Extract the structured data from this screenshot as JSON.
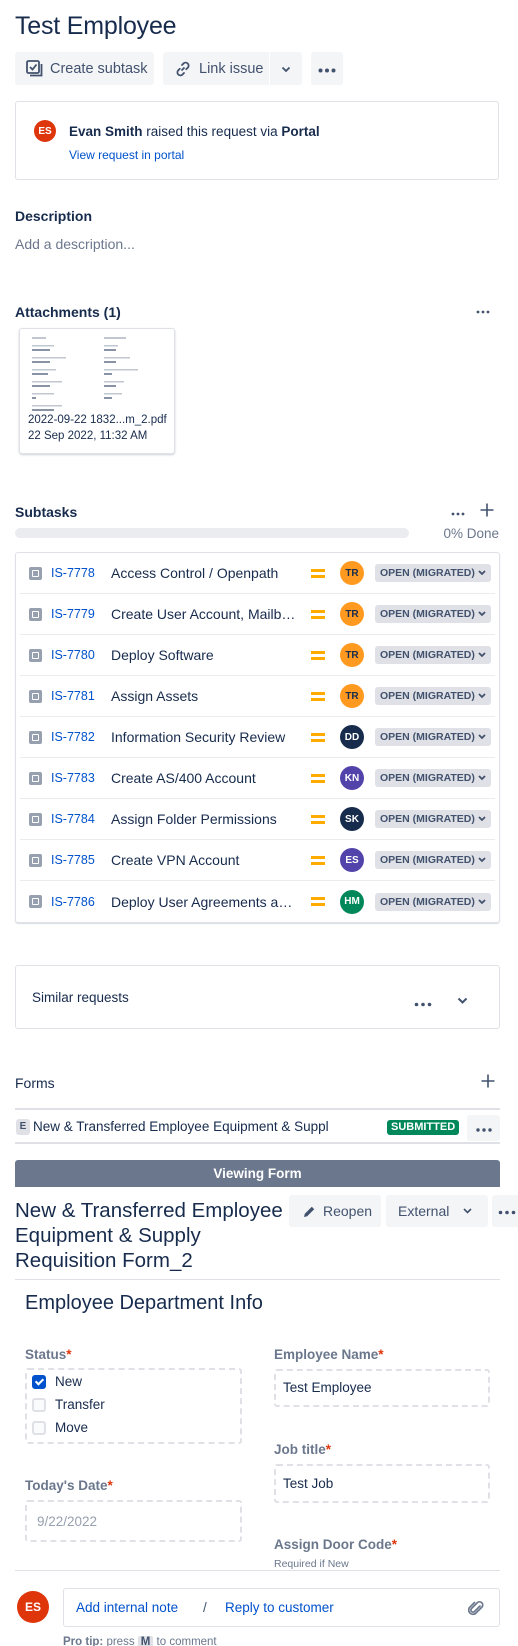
{
  "issue": {
    "title": "Test Employee"
  },
  "toolbar": {
    "create_subtask": "Create subtask",
    "link_issue": "Link issue",
    "more_icon": "more-horizontal-icon"
  },
  "raised": {
    "avatar_initials": "ES",
    "avatar_color": "#de350b",
    "reporter": "Evan Smith",
    "middle": " raised this request via ",
    "channel": "Portal",
    "view_link": "View request in portal"
  },
  "description": {
    "label": "Description",
    "placeholder": "Add a description..."
  },
  "attachments": {
    "label": "Attachments (1)",
    "files": [
      {
        "name": "2022-09-22 1832...m_2.pdf",
        "date": "22 Sep 2022, 11:32 AM"
      }
    ]
  },
  "subtasks": {
    "label": "Subtasks",
    "progress_percent": 0,
    "progress_text": "0% Done",
    "items": [
      {
        "key": "IS-7778",
        "summary": "Access Control / Openpath",
        "priority": "medium",
        "assignee": "TR",
        "assignee_color": "#ff991f",
        "assignee_text_color": "#172b4d",
        "status": "OPEN (MIGRATED)"
      },
      {
        "key": "IS-7779",
        "summary": "Create User Account, Mailbo...",
        "priority": "medium",
        "assignee": "TR",
        "assignee_color": "#ff991f",
        "assignee_text_color": "#172b4d",
        "status": "OPEN (MIGRATED)"
      },
      {
        "key": "IS-7780",
        "summary": "Deploy Software",
        "priority": "medium",
        "assignee": "TR",
        "assignee_color": "#ff991f",
        "assignee_text_color": "#172b4d",
        "status": "OPEN (MIGRATED)"
      },
      {
        "key": "IS-7781",
        "summary": "Assign Assets",
        "priority": "medium",
        "assignee": "TR",
        "assignee_color": "#ff991f",
        "assignee_text_color": "#172b4d",
        "status": "OPEN (MIGRATED)"
      },
      {
        "key": "IS-7782",
        "summary": "Information Security Review",
        "priority": "medium",
        "assignee": "DD",
        "assignee_color": "#172b4d",
        "assignee_text_color": "#ffffff",
        "status": "OPEN (MIGRATED)"
      },
      {
        "key": "IS-7783",
        "summary": "Create AS/400 Account",
        "priority": "medium",
        "assignee": "KN",
        "assignee_color": "#5243aa",
        "assignee_text_color": "#ffffff",
        "status": "OPEN (MIGRATED)"
      },
      {
        "key": "IS-7784",
        "summary": "Assign Folder Permissions",
        "priority": "medium",
        "assignee": "SK",
        "assignee_color": "#172b4d",
        "assignee_text_color": "#ffffff",
        "status": "OPEN (MIGRATED)"
      },
      {
        "key": "IS-7785",
        "summary": "Create VPN Account",
        "priority": "medium",
        "assignee": "ES",
        "assignee_color": "#5243aa",
        "assignee_text_color": "#ffffff",
        "status": "OPEN (MIGRATED)"
      },
      {
        "key": "IS-7786",
        "summary": "Deploy User Agreements an...",
        "priority": "medium",
        "assignee": "HM",
        "assignee_color": "#00875a",
        "assignee_text_color": "#ffffff",
        "status": "OPEN (MIGRATED)"
      }
    ]
  },
  "similar": {
    "label": "Similar requests"
  },
  "forms": {
    "label": "Forms",
    "items": [
      {
        "badge": "E",
        "name": "New & Transferred Employee Equipment & Suppl",
        "status": "SUBMITTED",
        "status_color": "#00875a"
      }
    ],
    "viewing_banner": "Viewing Form",
    "form_title": "New & Transferred Employee Equipment & Supply Requisition Form_2",
    "reopen": "Reopen",
    "visibility": "External",
    "section_heading": "Employee Department Info",
    "fields": {
      "status": {
        "label": "Status",
        "required": "*",
        "options": [
          {
            "label": "New",
            "checked": true
          },
          {
            "label": "Transfer",
            "checked": false
          },
          {
            "label": "Move",
            "checked": false
          }
        ]
      },
      "employee_name": {
        "label": "Employee Name",
        "required": "*",
        "value": "Test Employee"
      },
      "job_title": {
        "label": "Job title",
        "required": "*",
        "value": "Test Job"
      },
      "todays_date": {
        "label": "Today's Date",
        "required": "*",
        "value": "9/22/2022"
      },
      "door_code": {
        "label": "Assign Door Code",
        "required": "*",
        "help": "Required if New"
      }
    }
  },
  "comment": {
    "avatar_initials": "ES",
    "avatar_color": "#de350b",
    "internal_note": "Add internal note",
    "separator": "/",
    "reply": "Reply to customer",
    "pro_tip_bold": "Pro tip:",
    "pro_tip_pre": " press ",
    "pro_tip_key": "M",
    "pro_tip_post": " to comment"
  }
}
